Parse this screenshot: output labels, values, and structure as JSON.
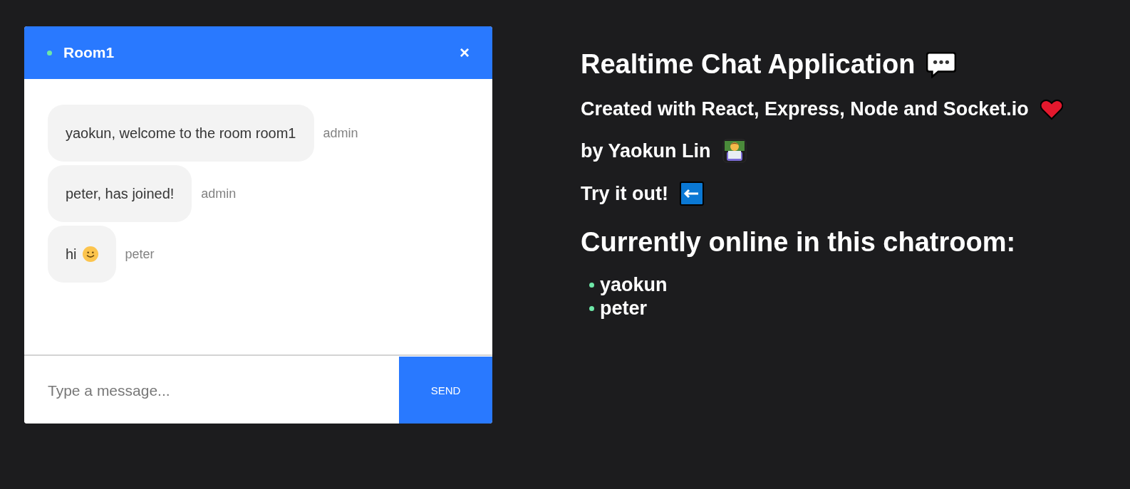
{
  "chat": {
    "room": "Room1",
    "close": "×",
    "messages": [
      {
        "text": "yaokun, welcome to the room room1",
        "sender": "admin",
        "emoji": false
      },
      {
        "text": "peter, has joined!",
        "sender": "admin",
        "emoji": false
      },
      {
        "text": "hi",
        "sender": "peter",
        "emoji": true
      }
    ],
    "input": {
      "placeholder": "Type a message..."
    },
    "send": "SEND"
  },
  "info": {
    "title": "Realtime Chat Application",
    "created": "Created with React, Express, Node and Socket.io",
    "author": "by Yaokun Lin",
    "try": "Try it out!",
    "online_title": "Currently online in this chatroom:",
    "online": [
      "yaokun",
      "peter"
    ]
  }
}
